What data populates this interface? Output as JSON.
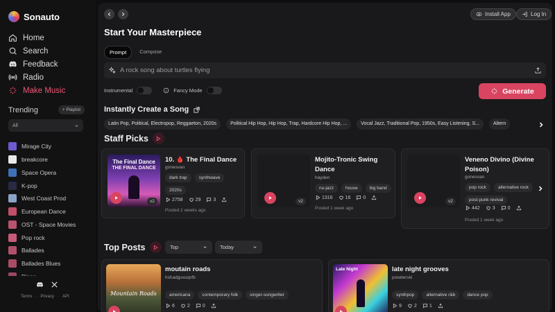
{
  "brand": {
    "name": "Sonauto"
  },
  "nav": [
    {
      "label": "Home",
      "icon": "home-icon",
      "active": false
    },
    {
      "label": "Search",
      "icon": "search-icon",
      "active": false
    },
    {
      "label": "Feedback",
      "icon": "discord-icon",
      "active": false
    },
    {
      "label": "Radio",
      "icon": "radio-icon",
      "active": false
    },
    {
      "label": "Make Music",
      "icon": "sparkle-icon",
      "active": true
    }
  ],
  "trending": {
    "title": "Trending",
    "playlist_label": "Playlist",
    "filter_value": "All",
    "items": [
      {
        "label": "Mirage City",
        "color": "#6d5bd0"
      },
      {
        "label": "breakcore",
        "color": "#e8e8e8"
      },
      {
        "label": "Space Opera",
        "color": "#3f6fb5"
      },
      {
        "label": "K-pop",
        "color": "#2a2a44"
      },
      {
        "label": "West Coast Prod",
        "color": "#8aa4c8"
      },
      {
        "label": "European Dance",
        "color": "#c0506a"
      },
      {
        "label": "OST - Space Movies",
        "color": "#b85470"
      },
      {
        "label": "Pop rock",
        "color": "#c85a78"
      },
      {
        "label": "Ballades",
        "color": "#b2506c"
      },
      {
        "label": "Ballades Blues",
        "color": "#a84c66"
      },
      {
        "label": "Disco",
        "color": "#9c4862"
      }
    ]
  },
  "footer": {
    "terms": "Terms",
    "sep1": "·",
    "privacy": "Privacy",
    "sep2": "·",
    "api": "API"
  },
  "header": {
    "install_label": "Install App",
    "login_label": "Log In"
  },
  "composer": {
    "title": "Start Your Masterpiece",
    "tabs": [
      "Prompt",
      "Compose"
    ],
    "prompt_placeholder": "A rock song about turtles flying",
    "instrumental_label": "Instrumental",
    "fancy_label": "Fancy Mode",
    "generate_label": "Generate"
  },
  "instant": {
    "title": "Instantly Create a Song",
    "chips": [
      "Latin Pop, Political, Electropop, Reggaeton, 2020s",
      "Political Hip Hop, Hip Hop, Trap, Hardcore Hip Hop, ...",
      "Vocal Jazz, Traditional Pop, 1950s, Easy Listening, S...",
      "Altern"
    ]
  },
  "staff_picks": {
    "title": "Staff Picks",
    "cards": [
      {
        "title": "10. 🩸 The Final Dance",
        "user": "gonesvan",
        "tags": [
          "dark trap",
          "synthwave",
          "2020s"
        ],
        "plays": "2758",
        "likes": "29",
        "comments": "3",
        "posted": "Posted 2 weeks ago",
        "art_text_top": "The Final Dance",
        "art_text_bottom": "THE FINAL DANCE"
      },
      {
        "title": "Mojito-Tronic Swing Dance",
        "user": "hayden",
        "tags": [
          "nu-jazz",
          "house",
          "big band"
        ],
        "plays": "1316",
        "likes": "16",
        "comments": "0",
        "posted": "Posted 1 week ago"
      },
      {
        "title": "Veneno Divino (Divine Poison)",
        "user": "gonesvan",
        "tags": [
          "pop rock",
          "alternative rock",
          "post-punk revival"
        ],
        "plays": "442",
        "likes": "3",
        "comments": "0",
        "posted": "Posted 1 week ago"
      }
    ],
    "version_label": "v2"
  },
  "top_posts": {
    "title": "Top Posts",
    "sort_value": "Top",
    "range_value": "Today",
    "cards": [
      {
        "title": "moutain roads",
        "user": "hshadgsxuqvfb",
        "tags": [
          "americana",
          "contemporary folk",
          "singer-songwriter"
        ],
        "plays": "6",
        "likes": "2",
        "comments": "0",
        "art_text": "Mountain Roads"
      },
      {
        "title": "late night grooves",
        "user": "powderski",
        "tags": [
          "synthpop",
          "alternative r&b",
          "dance pop"
        ],
        "plays": "9",
        "likes": "2",
        "comments": "1",
        "art_text": "Late Night"
      }
    ]
  },
  "colors": {
    "accent": "#d94460",
    "active_nav": "#ef5574",
    "panel": "#19191b"
  }
}
